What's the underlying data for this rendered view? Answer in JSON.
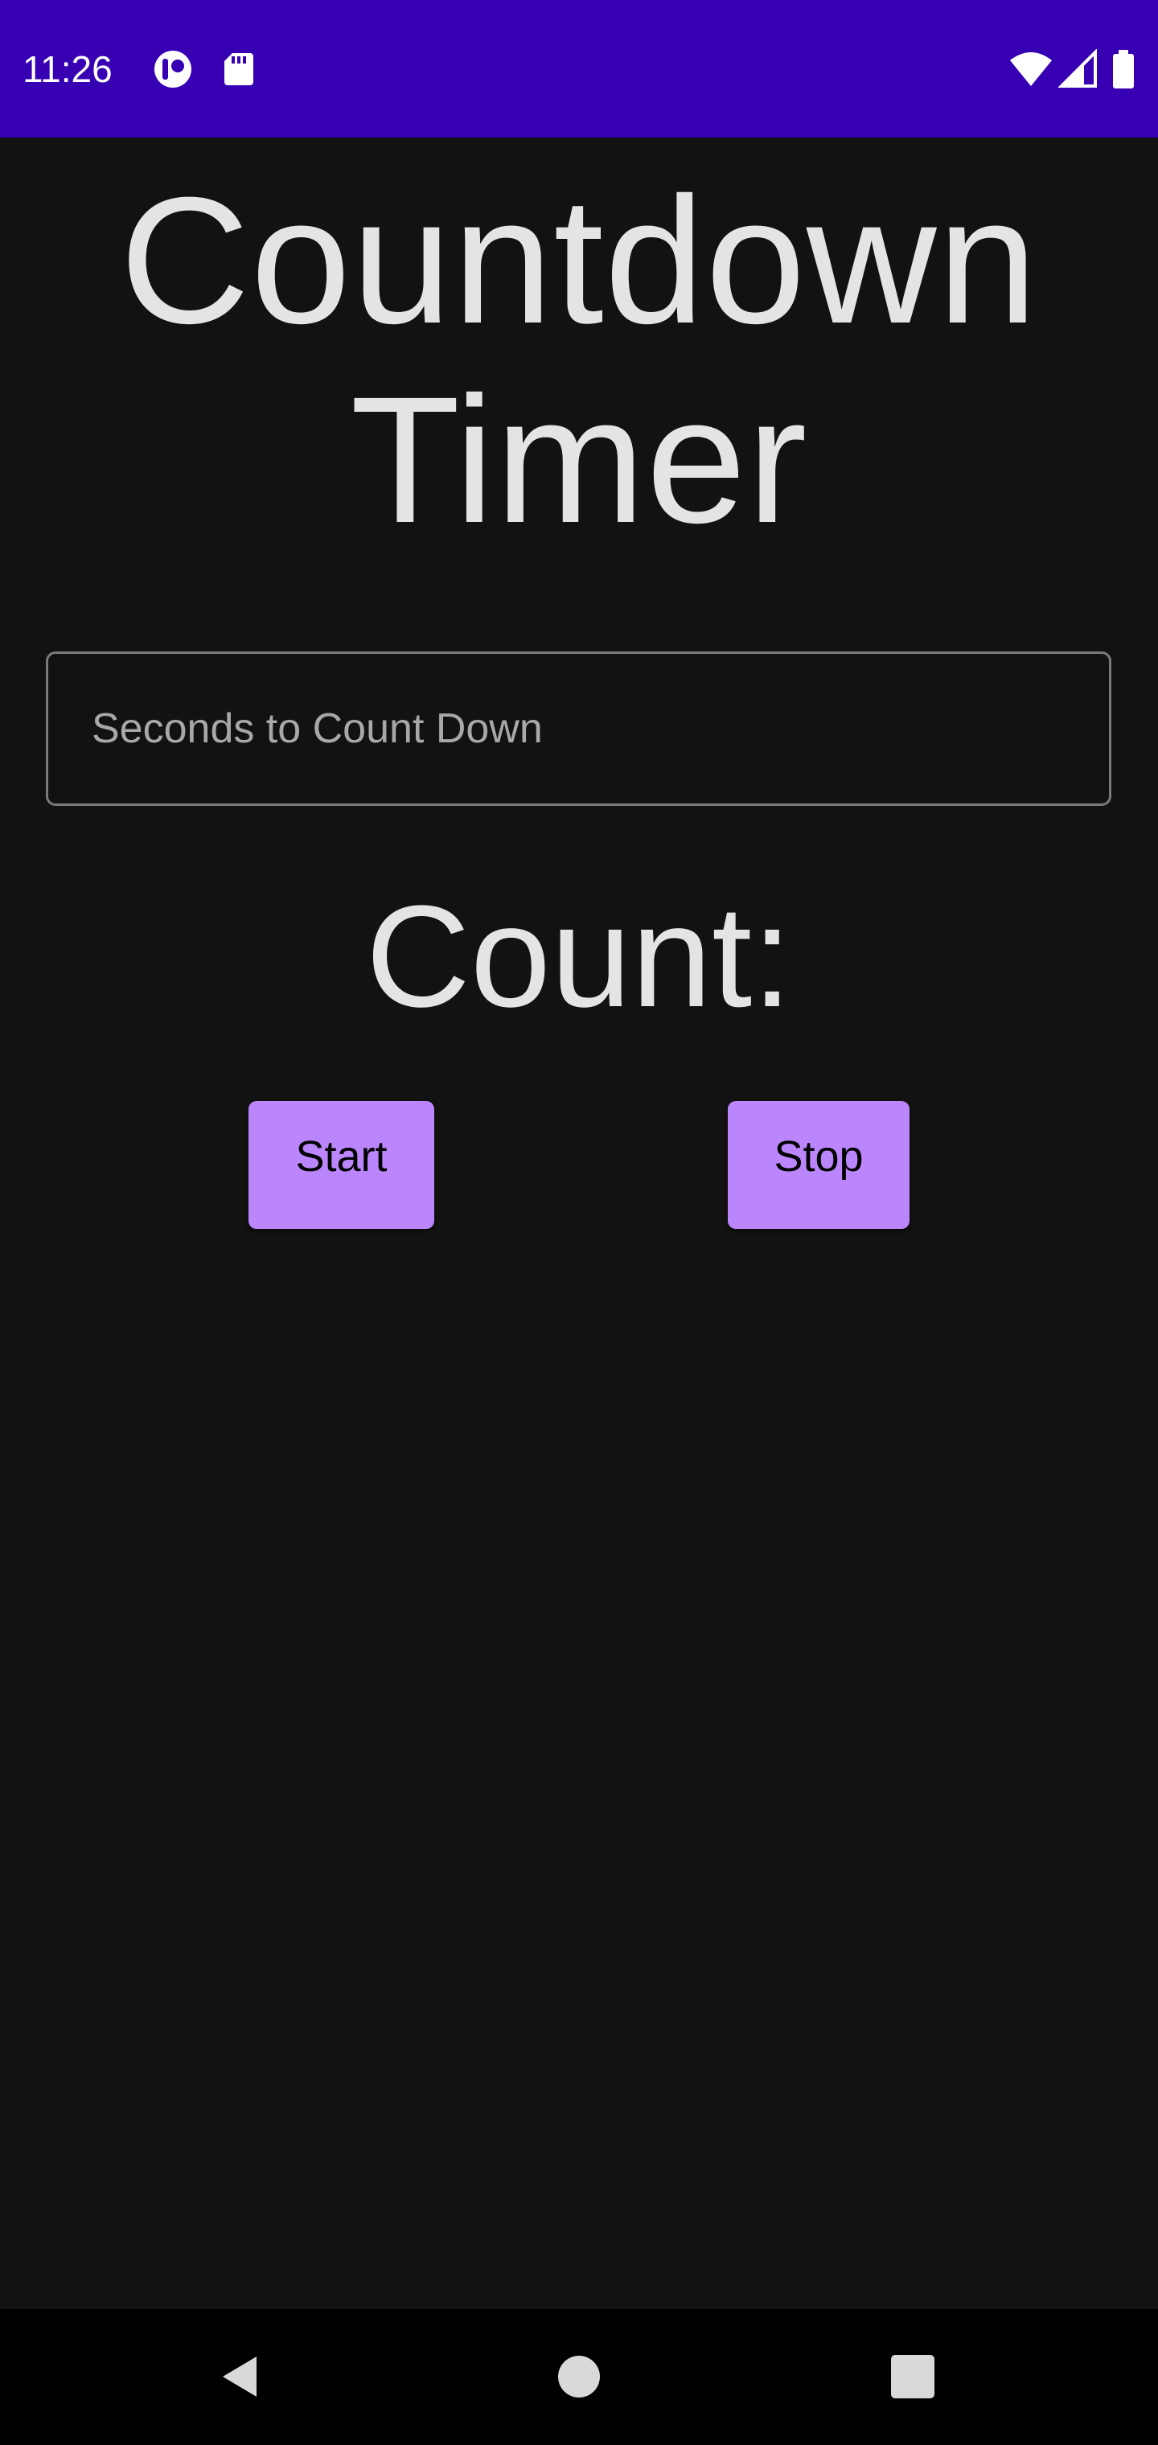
{
  "status_bar": {
    "time": "11:26",
    "background": "#3700b3",
    "left_icons": [
      "notification-app-icon",
      "sd-card-icon"
    ],
    "right_icons": [
      "wifi-icon",
      "cellular-signal-icon",
      "battery-icon"
    ]
  },
  "app": {
    "title_line1": "Countdown",
    "title_line2": "Timer",
    "seconds_input": {
      "placeholder": "Seconds to Count Down",
      "value": ""
    },
    "count_label": "Count:",
    "start_label": "Start",
    "stop_label": "Stop",
    "accent_color": "#bb86fc",
    "background_color": "#121212"
  },
  "nav_bar": {
    "buttons": [
      "back-icon",
      "home-icon",
      "recents-icon"
    ]
  }
}
